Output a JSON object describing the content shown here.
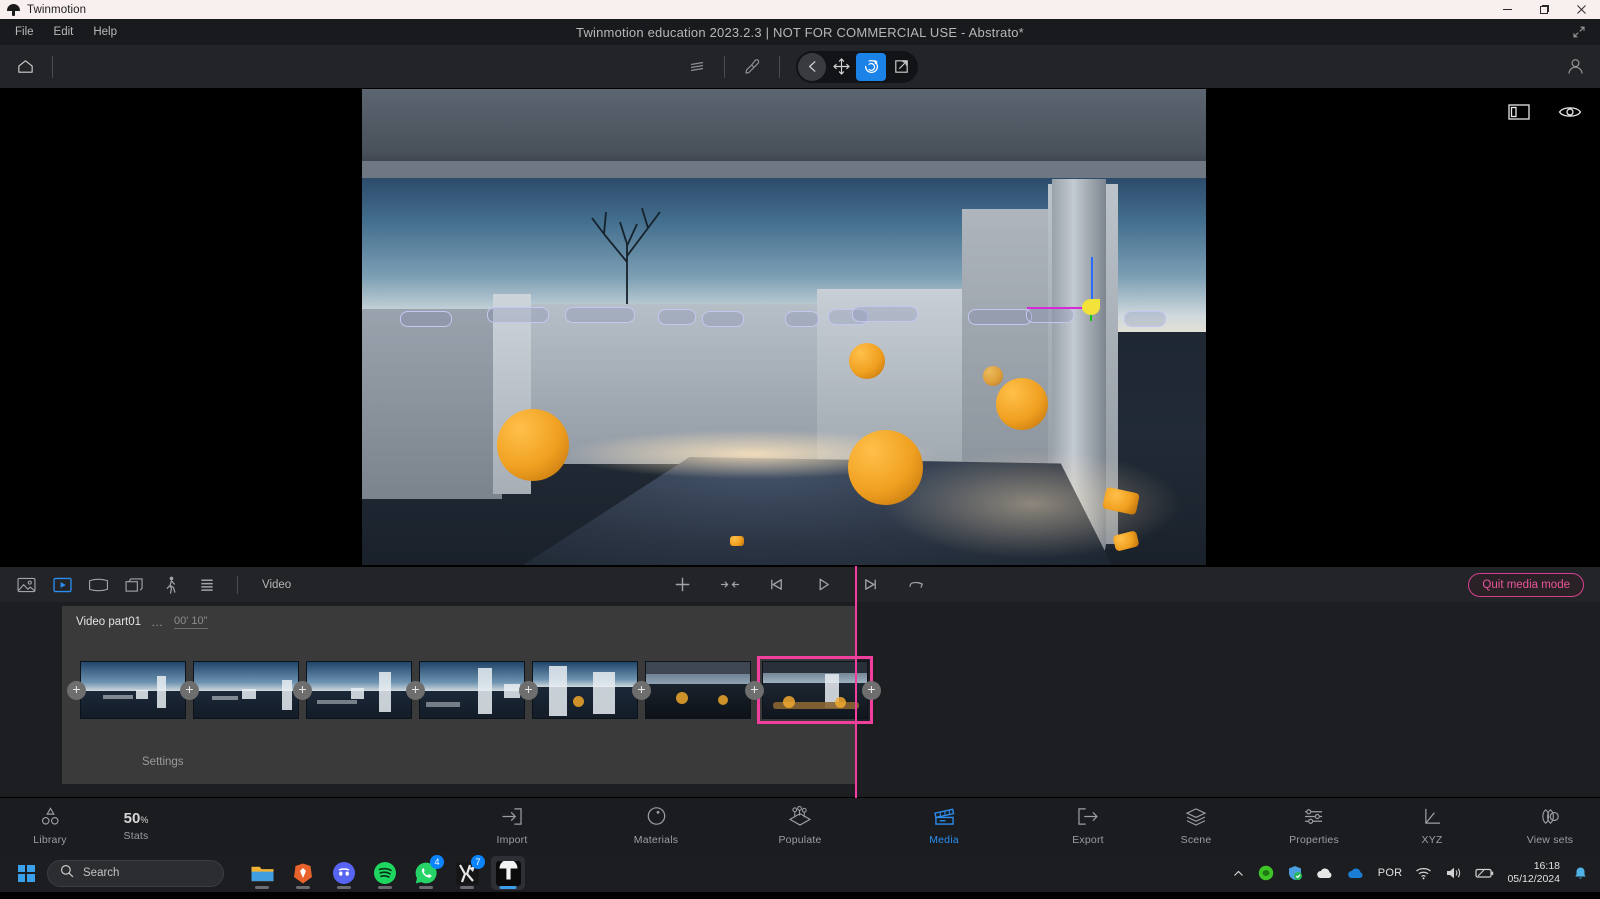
{
  "window": {
    "app_name": "Twinmotion",
    "title": "Twinmotion education 2023.2.3 | NOT FOR COMMERCIAL USE - Abstrato*",
    "minimize": "—",
    "maximize": "❐",
    "close": "✕"
  },
  "menu": {
    "items": [
      {
        "label": "File"
      },
      {
        "label": "Edit"
      },
      {
        "label": "Help"
      }
    ],
    "expand_icon": "expand-arrow-icon"
  },
  "toolbar": {
    "home_icon": "home-icon",
    "layers_icon": "layers-icon",
    "eyedropper_icon": "eyedropper-icon",
    "back_icon": "back-arrow-icon",
    "move_icon": "move-tool-icon",
    "rotate_icon": "rotate-tool-icon",
    "scale_icon": "scale-tool-icon",
    "account_icon": "user-account-icon",
    "active_gizmo": "rotate"
  },
  "viewport": {
    "panel_toggle_icon": "panel-toggle-icon",
    "visibility_icon": "eye-visibility-icon"
  },
  "media_bar": {
    "modes": [
      {
        "name": "image-mode-icon",
        "label": "Image",
        "active": false
      },
      {
        "name": "video-mode-icon",
        "label": "Video",
        "active": true
      },
      {
        "name": "panorama-mode-icon",
        "label": "Panorama",
        "active": false
      },
      {
        "name": "presentation-mode-icon",
        "label": "Presentation",
        "active": false
      },
      {
        "name": "walkthrough-mode-icon",
        "label": "Phasing",
        "active": false
      },
      {
        "name": "list-mode-icon",
        "label": "List",
        "active": false
      }
    ],
    "current_mode_label": "Video",
    "playback": [
      {
        "name": "add-keyframe-icon",
        "glyph": "+"
      },
      {
        "name": "collapse-icon",
        "glyph": "→←"
      },
      {
        "name": "skip-to-start-icon",
        "glyph": "⏮"
      },
      {
        "name": "play-icon",
        "glyph": "▷"
      },
      {
        "name": "skip-to-end-icon",
        "glyph": "⏭"
      },
      {
        "name": "loop-icon",
        "glyph": "⟶"
      }
    ],
    "quit_label": "Quit media mode"
  },
  "timeline": {
    "clip_title": "Video part01",
    "more_dots": "…",
    "duration": "00' 10\"",
    "settings_label": "Settings",
    "add_glyph": "+",
    "keyframes": [
      {
        "id": 1,
        "selected": false
      },
      {
        "id": 2,
        "selected": false
      },
      {
        "id": 3,
        "selected": false
      },
      {
        "id": 4,
        "selected": false
      },
      {
        "id": 5,
        "selected": false
      },
      {
        "id": 6,
        "selected": false
      },
      {
        "id": 7,
        "selected": true
      }
    ]
  },
  "bottom_nav": {
    "left": [
      {
        "label": "Library",
        "icon": "library-shapes-icon"
      },
      {
        "label": "Stats",
        "icon": "stats-percentage",
        "value": "50",
        "unit": "%"
      }
    ],
    "center": [
      {
        "label": "Import",
        "icon": "import-arrow-icon",
        "active": false
      },
      {
        "label": "Materials",
        "icon": "materials-sphere-icon",
        "active": false
      },
      {
        "label": "Populate",
        "icon": "populate-people-icon",
        "active": false
      },
      {
        "label": "Media",
        "icon": "media-clapperboard-icon",
        "active": true
      },
      {
        "label": "Export",
        "icon": "export-arrow-icon",
        "active": false
      }
    ],
    "right": [
      {
        "label": "Scene",
        "icon": "scene-layers-icon"
      },
      {
        "label": "Properties",
        "icon": "properties-sliders-icon"
      },
      {
        "label": "XYZ",
        "icon": "xyz-axis-icon"
      },
      {
        "label": "View sets",
        "icon": "view-sets-icon"
      }
    ]
  },
  "taskbar": {
    "start_icon": "windows-start-icon",
    "search_placeholder": "Search",
    "search_icon": "search-icon",
    "apps": [
      {
        "name": "file-explorer-icon",
        "badge": "",
        "active": false
      },
      {
        "name": "brave-browser-icon",
        "badge": "",
        "active": false
      },
      {
        "name": "discord-icon",
        "badge": "",
        "active": false
      },
      {
        "name": "spotify-icon",
        "badge": "",
        "active": false
      },
      {
        "name": "whatsapp-icon",
        "badge": "4",
        "active": false
      },
      {
        "name": "gaming-app-icon",
        "badge": "7",
        "active": false
      },
      {
        "name": "twinmotion-taskbar-icon",
        "badge": "",
        "active": true
      }
    ],
    "tray": {
      "chevron_icon": "show-hidden-icons-chevron",
      "items": [
        {
          "name": "nvidia-icon"
        },
        {
          "name": "security-shield-icon"
        },
        {
          "name": "cloud-icon"
        },
        {
          "name": "onedrive-icon"
        }
      ],
      "language": "POR",
      "wifi_icon": "wifi-icon",
      "volume_icon": "volume-icon",
      "battery_icon": "battery-icon",
      "time": "16:18",
      "date": "05/12/2024",
      "notification_icon": "notification-bell-icon"
    }
  },
  "colors": {
    "accent_blue": "#2b8ef0",
    "accent_pink": "#f23f9e",
    "panel_bg": "#232428",
    "timeline_bg": "#3a3a3a"
  }
}
